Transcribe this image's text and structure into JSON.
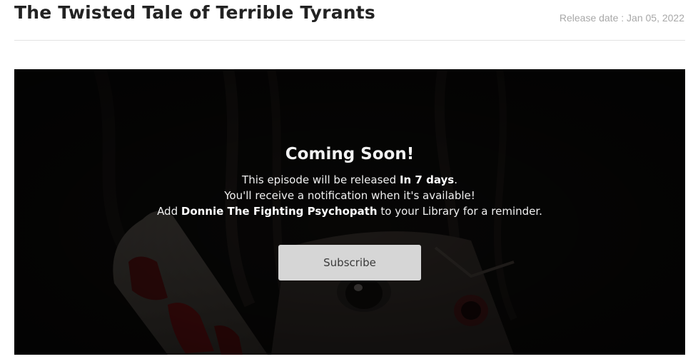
{
  "header": {
    "title": "The Twisted Tale of Terrible Tyrants",
    "release_date": "Release date : Jan 05, 2022"
  },
  "player": {
    "heading": "Coming Soon!",
    "line1_prefix": "This episode will be released ",
    "line1_highlight": "In 7 days",
    "line1_suffix": ".",
    "line2": "You'll receive a notification when it's available!",
    "line3_prefix": "Add ",
    "line3_highlight": "Donnie The Fighting Psychopath",
    "line3_suffix": " to your Library for a reminder.",
    "subscribe_label": "Subscribe"
  },
  "colors": {
    "background": "#ffffff",
    "title_text": "#222222",
    "date_text": "#a8a8a8",
    "player_background": "#090807",
    "button_background": "#d6d6d6"
  }
}
